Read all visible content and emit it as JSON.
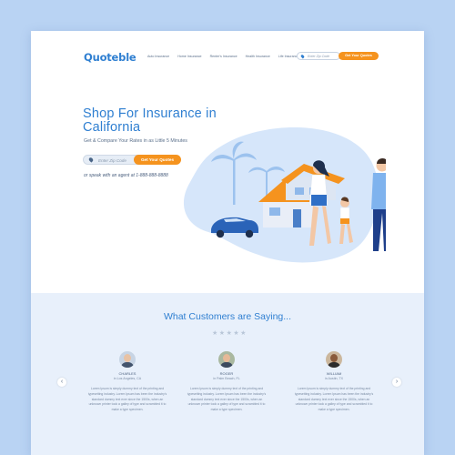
{
  "header": {
    "logo": "Quoteble",
    "nav": [
      "Auto Insurance",
      "Home Insurance",
      "Renter's Insurance",
      "Health Insurance",
      "Life Insurance"
    ],
    "zip_placeholder": "Enter Zip Code",
    "cta": "Get Your Quotes"
  },
  "hero": {
    "title": "Shop For Insurance in California",
    "subtitle": "Get & Compare Your Rates in as Little 5 Minutes",
    "zip_placeholder": "Enter Zip Code",
    "cta": "Get Your Quotes",
    "phone_text": "or speak with an agent at 1-888-888-8888"
  },
  "testimonials": {
    "title": "What Customers are Saying...",
    "rating": 5,
    "prev_icon": "chevron-left-icon",
    "next_icon": "chevron-right-icon",
    "items": [
      {
        "name": "CHARLES",
        "location": "in Los Angeles, CA",
        "quote": "Lorem Ipsum is simply dummy text of the printing and typesetting industry. Lorem Ipsum has been the industry's standard dummy text ever since the 1500s, when an unknown printer took a galley of type and scrambled it to make a type specimen."
      },
      {
        "name": "ROGER",
        "location": "in Palm Beach, FL",
        "quote": "Lorem Ipsum is simply dummy text of the printing and typesetting industry. Lorem Ipsum has been the industry's standard dummy text ever since the 1500s, when an unknown printer took a galley of type and scrambled it to make a type specimen."
      },
      {
        "name": "WILLIAM",
        "location": "in Austin, TX",
        "quote": "Lorem Ipsum is simply dummy text of the printing and typesetting industry. Lorem Ipsum has been the industry's standard dummy text ever since the 1500s, when an unknown printer took a galley of type and scrambled it to make a type specimen."
      }
    ]
  },
  "colors": {
    "brand_blue": "#2f7fd1",
    "cta_orange": "#f5931e",
    "page_background": "#b9d3f3",
    "testimonial_band": "#e8f0fb"
  }
}
